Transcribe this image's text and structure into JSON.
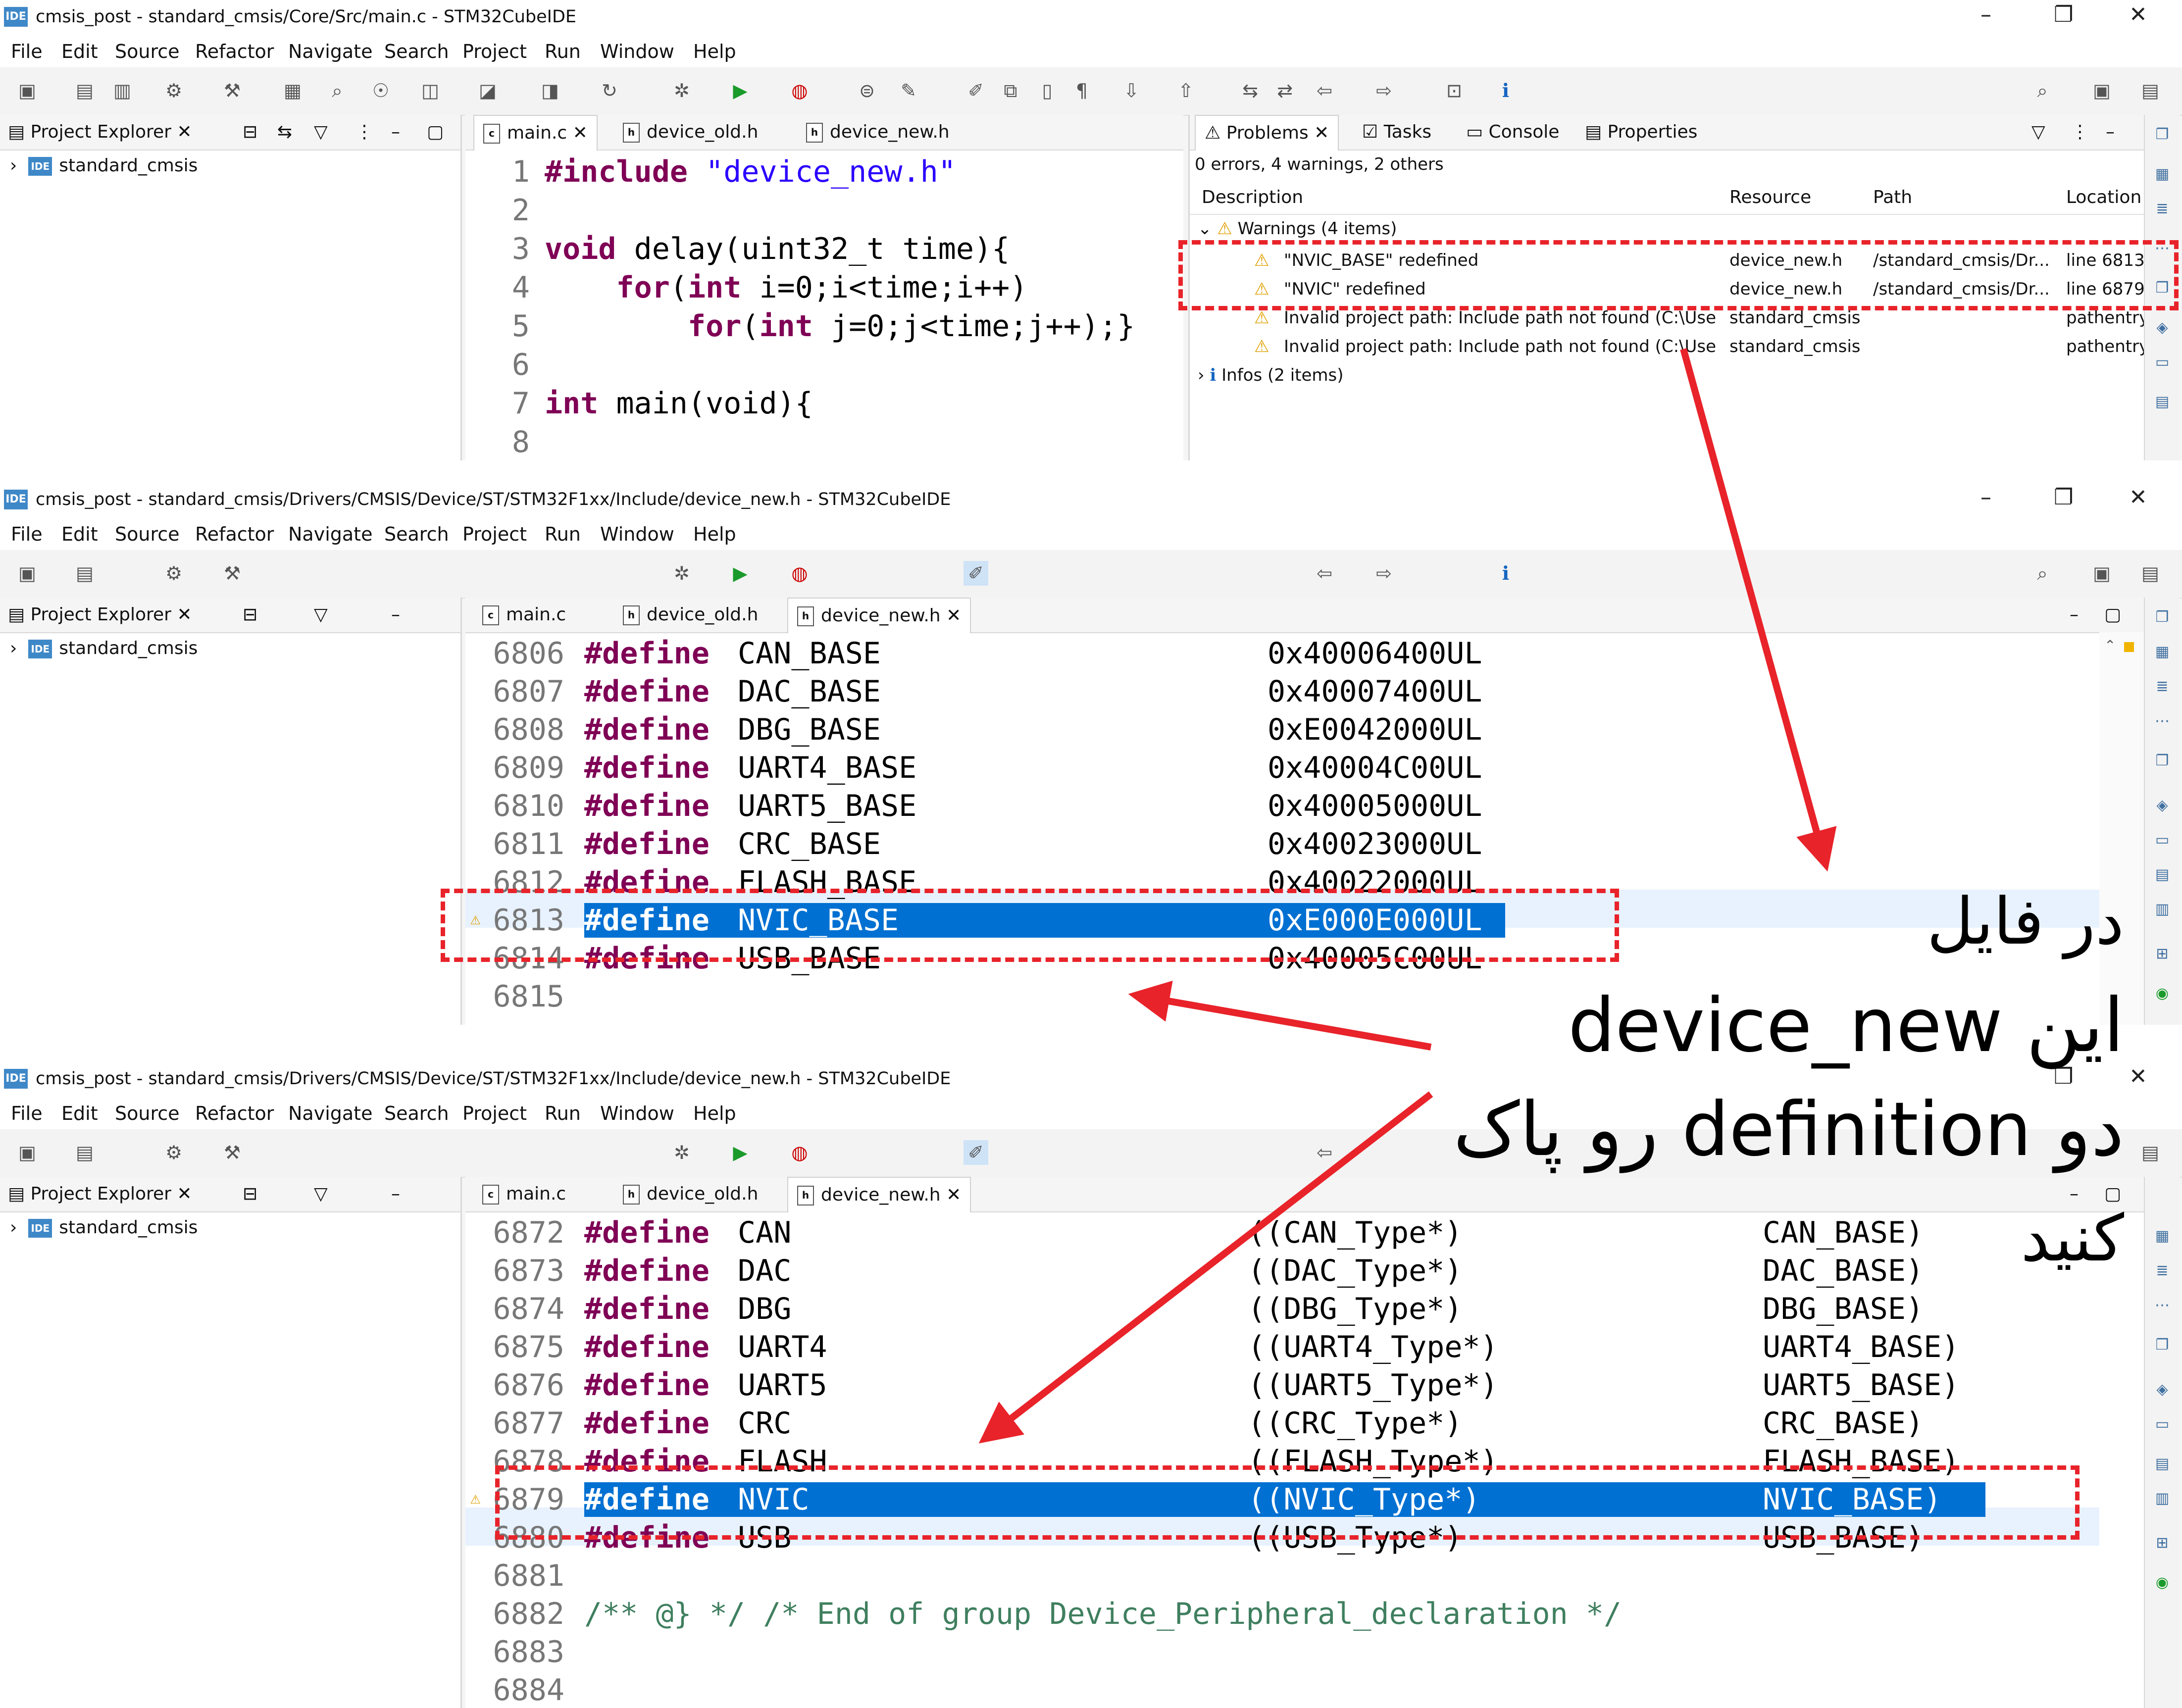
{
  "windows": [
    {
      "title": "cmsis_post - standard_cmsis/Core/Src/main.c - STM32CubeIDE",
      "menu": [
        "File",
        "Edit",
        "Source",
        "Refactor",
        "Navigate",
        "Search",
        "Project",
        "Run",
        "Window",
        "Help"
      ],
      "project_explorer": {
        "tab": "Project Explorer",
        "project": "standard_cmsis"
      },
      "editor_tabs": [
        "main.c",
        "device_old.h",
        "device_new.h"
      ],
      "active_tab": 0,
      "code": {
        "line_numbers": [
          "1",
          "2",
          "3",
          "4",
          "5",
          "6",
          "7",
          "8"
        ],
        "lines": [
          "#include \"device_new.h\"",
          "",
          "void delay(uint32_t time){",
          "    for(int i=0;i<time;i++)",
          "        for(int j=0;j<time;j++);}",
          "",
          "int main(void){",
          ""
        ]
      },
      "problems_view": {
        "tabs": [
          "Problems",
          "Tasks",
          "Console",
          "Properties"
        ],
        "summary": "0 errors, 4 warnings, 2 others",
        "columns": [
          "Description",
          "Resource",
          "Path",
          "Location"
        ],
        "groups": [
          {
            "label": "Warnings (4 items)",
            "rows": [
              {
                "description": "\"NVIC_BASE\" redefined",
                "resource": "device_new.h",
                "path": "/standard_cmsis/Dr...",
                "location": "line 6813"
              },
              {
                "description": "\"NVIC\" redefined",
                "resource": "device_new.h",
                "path": "/standard_cmsis/Dr...",
                "location": "line 6879"
              },
              {
                "description": "Invalid project path: Include path not found (C:\\Use",
                "resource": "standard_cmsis",
                "path": "",
                "location": "pathentry"
              },
              {
                "description": "Invalid project path: Include path not found (C:\\Use",
                "resource": "standard_cmsis",
                "path": "",
                "location": "pathentry"
              }
            ]
          },
          {
            "label": "Infos (2 items)",
            "rows": []
          }
        ]
      }
    },
    {
      "title": "cmsis_post - standard_cmsis/Drivers/CMSIS/Device/ST/STM32F1xx/Include/device_new.h - STM32CubeIDE",
      "menu": [
        "File",
        "Edit",
        "Source",
        "Refactor",
        "Navigate",
        "Search",
        "Project",
        "Run",
        "Window",
        "Help"
      ],
      "project_explorer": {
        "tab": "Project Explorer",
        "project": "standard_cmsis"
      },
      "editor_tabs": [
        "main.c",
        "device_old.h",
        "device_new.h"
      ],
      "active_tab": 2,
      "code_rows": [
        {
          "n": "6806",
          "name": "CAN_BASE",
          "value": "0x40006400UL"
        },
        {
          "n": "6807",
          "name": "DAC_BASE",
          "value": "0x40007400UL"
        },
        {
          "n": "6808",
          "name": "DBG_BASE",
          "value": "0xE0042000UL"
        },
        {
          "n": "6809",
          "name": "UART4_BASE",
          "value": "0x40004C00UL"
        },
        {
          "n": "6810",
          "name": "UART5_BASE",
          "value": "0x40005000UL"
        },
        {
          "n": "6811",
          "name": "CRC_BASE",
          "value": "0x40023000UL"
        },
        {
          "n": "6812",
          "name": "FLASH_BASE",
          "value": "0x40022000UL"
        },
        {
          "n": "6813",
          "name": "NVIC_BASE",
          "value": "0xE000E000UL"
        },
        {
          "n": "6814",
          "name": "USB_BASE",
          "value": "0x40005C00UL"
        },
        {
          "n": "6815",
          "name": "",
          "value": ""
        }
      ],
      "define_keyword": "#define"
    },
    {
      "title": "cmsis_post - standard_cmsis/Drivers/CMSIS/Device/ST/STM32F1xx/Include/device_new.h - STM32CubeIDE",
      "menu": [
        "File",
        "Edit",
        "Source",
        "Refactor",
        "Navigate",
        "Search",
        "Project",
        "Run",
        "Window",
        "Help"
      ],
      "project_explorer": {
        "tab": "Project Explorer",
        "project": "standard_cmsis"
      },
      "editor_tabs": [
        "main.c",
        "device_old.h",
        "device_new.h"
      ],
      "active_tab": 2,
      "code_rows": [
        {
          "n": "6872",
          "name": "CAN",
          "type": "((CAN_Type*)",
          "base": "CAN_BASE)"
        },
        {
          "n": "6873",
          "name": "DAC",
          "type": "((DAC_Type*)",
          "base": "DAC_BASE)"
        },
        {
          "n": "6874",
          "name": "DBG",
          "type": "((DBG_Type*)",
          "base": "DBG_BASE)"
        },
        {
          "n": "6875",
          "name": "UART4",
          "type": "((UART4_Type*)",
          "base": "UART4_BASE)"
        },
        {
          "n": "6876",
          "name": "UART5",
          "type": "((UART5_Type*)",
          "base": "UART5_BASE)"
        },
        {
          "n": "6877",
          "name": "CRC",
          "type": "((CRC_Type*)",
          "base": "CRC_BASE)"
        },
        {
          "n": "6878",
          "name": "FLASH",
          "type": "((FLASH_Type*)",
          "base": "FLASH_BASE)"
        },
        {
          "n": "6879",
          "name": "NVIC",
          "type": "((NVIC_Type*)",
          "base": "NVIC_BASE)"
        },
        {
          "n": "6880",
          "name": "USB",
          "type": "((USB_Type*)",
          "base": "USB_BASE)"
        },
        {
          "n": "6881",
          "name": "",
          "type": "",
          "base": ""
        },
        {
          "n": "6882",
          "comment": "/** @} */ /* End of group Device_Peripheral_declaration */"
        },
        {
          "n": "6883",
          "name": "",
          "type": "",
          "base": ""
        },
        {
          "n": "6884",
          "name": "",
          "type": "",
          "base": ""
        }
      ],
      "define_keyword": "#define"
    }
  ],
  "annotation": {
    "line1": "در فایل",
    "line2": "این device_new",
    "line3": "دو definition رو پاک",
    "line4": "کنید",
    "arrow_color": "#e8232a",
    "box_color": "#e8232a"
  },
  "colors": {
    "keyword": "#7f0055",
    "string": "#2a00ff",
    "comment": "#3f7f5f",
    "selection": "#0070d2",
    "warning": "#f0b400"
  }
}
